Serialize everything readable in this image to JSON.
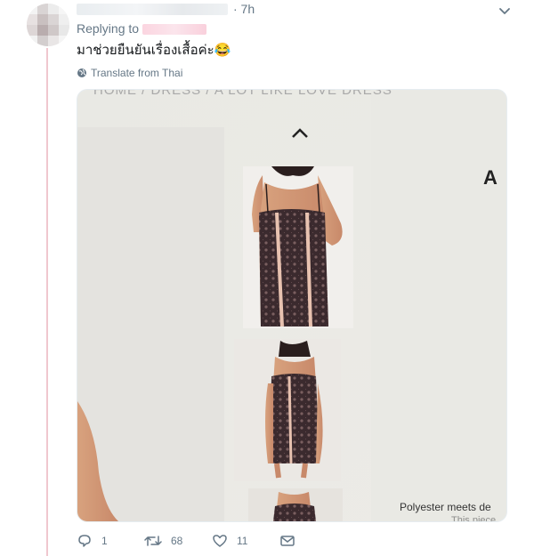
{
  "tweet": {
    "time": "· 7h",
    "replying_label": "Replying to",
    "text": "มาช่วยยืนยันเรื่องเสื้อค่ะ😂",
    "translate_label": "Translate from Thai"
  },
  "photo": {
    "breadcrumb": "HOME / DRESS / A LOT LIKE LOVE DRESS",
    "product_letter": "A",
    "caption_line": "Polyester meets de",
    "caption_line2": "This piece"
  },
  "actions": {
    "reply_count": "1",
    "retweet_count": "68",
    "like_count": "11"
  },
  "colors": {
    "accent": "#1da1f2",
    "muted": "#657786",
    "thread_line": "#f0c7cf"
  },
  "icons": [
    "avatar",
    "chevron-down-icon",
    "globe-icon",
    "reply-icon",
    "retweet-icon",
    "heart-icon",
    "mail-icon",
    "chevron-up-icon"
  ]
}
